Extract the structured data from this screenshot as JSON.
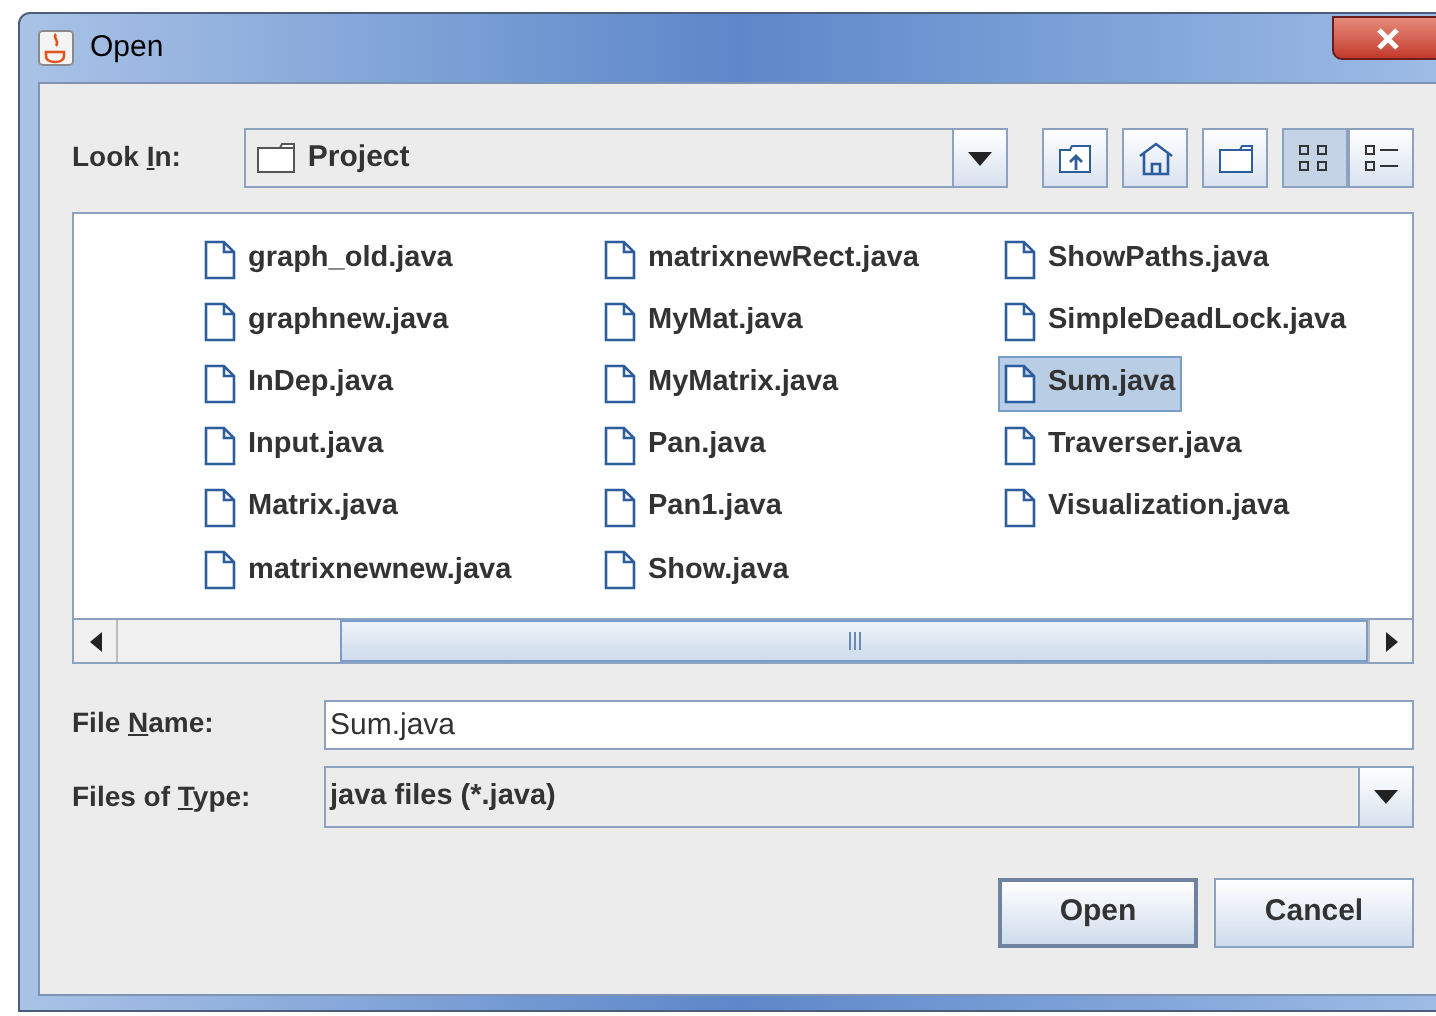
{
  "window": {
    "title": "Open"
  },
  "look_in": {
    "label": [
      "Look ",
      "I",
      "n:"
    ],
    "value": "Project"
  },
  "toolbar": [
    {
      "kind": "up",
      "selected": false
    },
    {
      "kind": "home",
      "selected": false
    },
    {
      "kind": "new-folder",
      "selected": false
    },
    {
      "kind": "list",
      "selected": true
    },
    {
      "kind": "details",
      "selected": false
    }
  ],
  "files": [
    {
      "name": "graph_old.java",
      "selected": false
    },
    {
      "name": "graphnew.java",
      "selected": false
    },
    {
      "name": "InDep.java",
      "selected": false
    },
    {
      "name": "Input.java",
      "selected": false
    },
    {
      "name": "Matrix.java",
      "selected": false
    },
    {
      "name": "matrixnewnew.java",
      "selected": false
    },
    {
      "name": "matrixnewRect.java",
      "selected": false
    },
    {
      "name": "MyMat.java",
      "selected": false
    },
    {
      "name": "MyMatrix.java",
      "selected": false
    },
    {
      "name": "Pan.java",
      "selected": false
    },
    {
      "name": "Pan1.java",
      "selected": false
    },
    {
      "name": "Show.java",
      "selected": false
    },
    {
      "name": "ShowPaths.java",
      "selected": false
    },
    {
      "name": "SimpleDeadLock.java",
      "selected": false
    },
    {
      "name": "Sum.java",
      "selected": true
    },
    {
      "name": "Traverser.java",
      "selected": false
    },
    {
      "name": "Visualization.java",
      "selected": false
    }
  ],
  "file_name": {
    "label": [
      "File ",
      "N",
      "ame:"
    ],
    "value": "Sum.java"
  },
  "files_of_type": {
    "label": [
      "Files of ",
      "T",
      "ype:"
    ],
    "value": "java files (*.java)"
  },
  "buttons": [
    "Open",
    "Cancel"
  ]
}
